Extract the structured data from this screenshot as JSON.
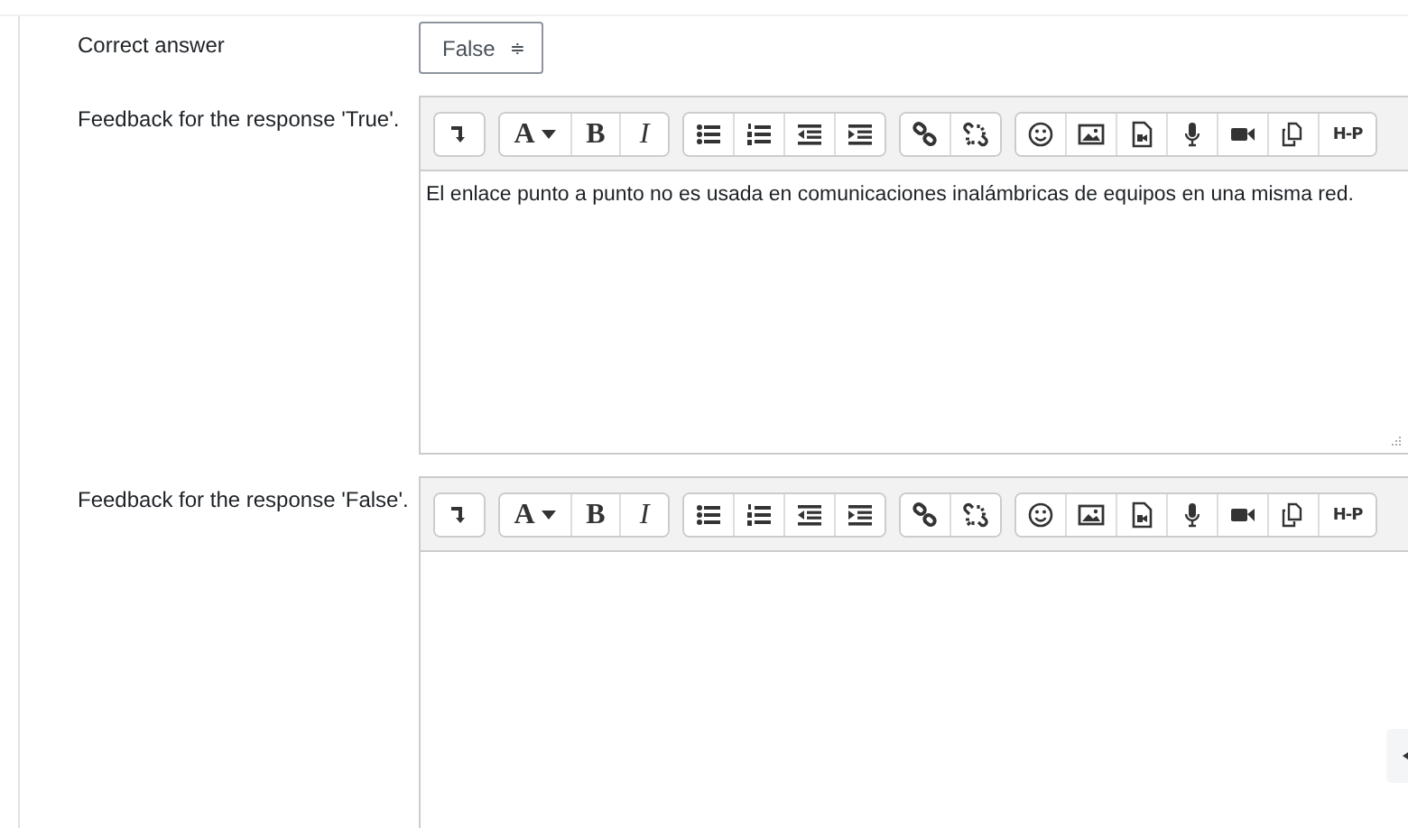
{
  "fields": [
    {
      "kind": "select",
      "label": "Correct answer",
      "value": "False",
      "arrow": "≑"
    },
    {
      "kind": "editor",
      "label": "Feedback for the response 'True'.",
      "content": "El enlace punto a punto no es usada en comunicaciones inalámbricas de equipos en una misma red.",
      "toolbar": [
        [
          {
            "kind": "icon"
          }
        ],
        [
          {
            "kind": "text",
            "label": "A"
          },
          {
            "kind": "text",
            "label": "B"
          },
          {
            "kind": "text",
            "label": "I"
          }
        ],
        [
          {
            "kind": "icon"
          },
          {
            "kind": "icon"
          },
          {
            "kind": "icon"
          },
          {
            "kind": "icon"
          }
        ],
        [
          {
            "kind": "icon"
          },
          {
            "kind": "icon"
          }
        ],
        [
          {
            "kind": "icon"
          },
          {
            "kind": "icon"
          },
          {
            "kind": "icon"
          },
          {
            "kind": "icon"
          },
          {
            "kind": "icon"
          },
          {
            "kind": "icon"
          },
          {
            "kind": "text",
            "label": "H-P"
          }
        ]
      ]
    },
    {
      "kind": "editor",
      "label": "Feedback for the response 'False'.",
      "toolbar": [
        [
          {
            "kind": "icon"
          }
        ],
        [
          {
            "kind": "text",
            "label": "A"
          },
          {
            "kind": "text",
            "label": "B"
          },
          {
            "kind": "text",
            "label": "I"
          }
        ],
        [
          {
            "kind": "icon"
          },
          {
            "kind": "icon"
          },
          {
            "kind": "icon"
          },
          {
            "kind": "icon"
          }
        ],
        [
          {
            "kind": "icon"
          },
          {
            "kind": "icon"
          }
        ],
        [
          {
            "kind": "icon"
          },
          {
            "kind": "icon"
          },
          {
            "kind": "icon"
          },
          {
            "kind": "icon"
          },
          {
            "kind": "icon"
          },
          {
            "kind": "icon"
          },
          {
            "kind": "text",
            "label": "H-P"
          }
        ]
      ]
    }
  ]
}
